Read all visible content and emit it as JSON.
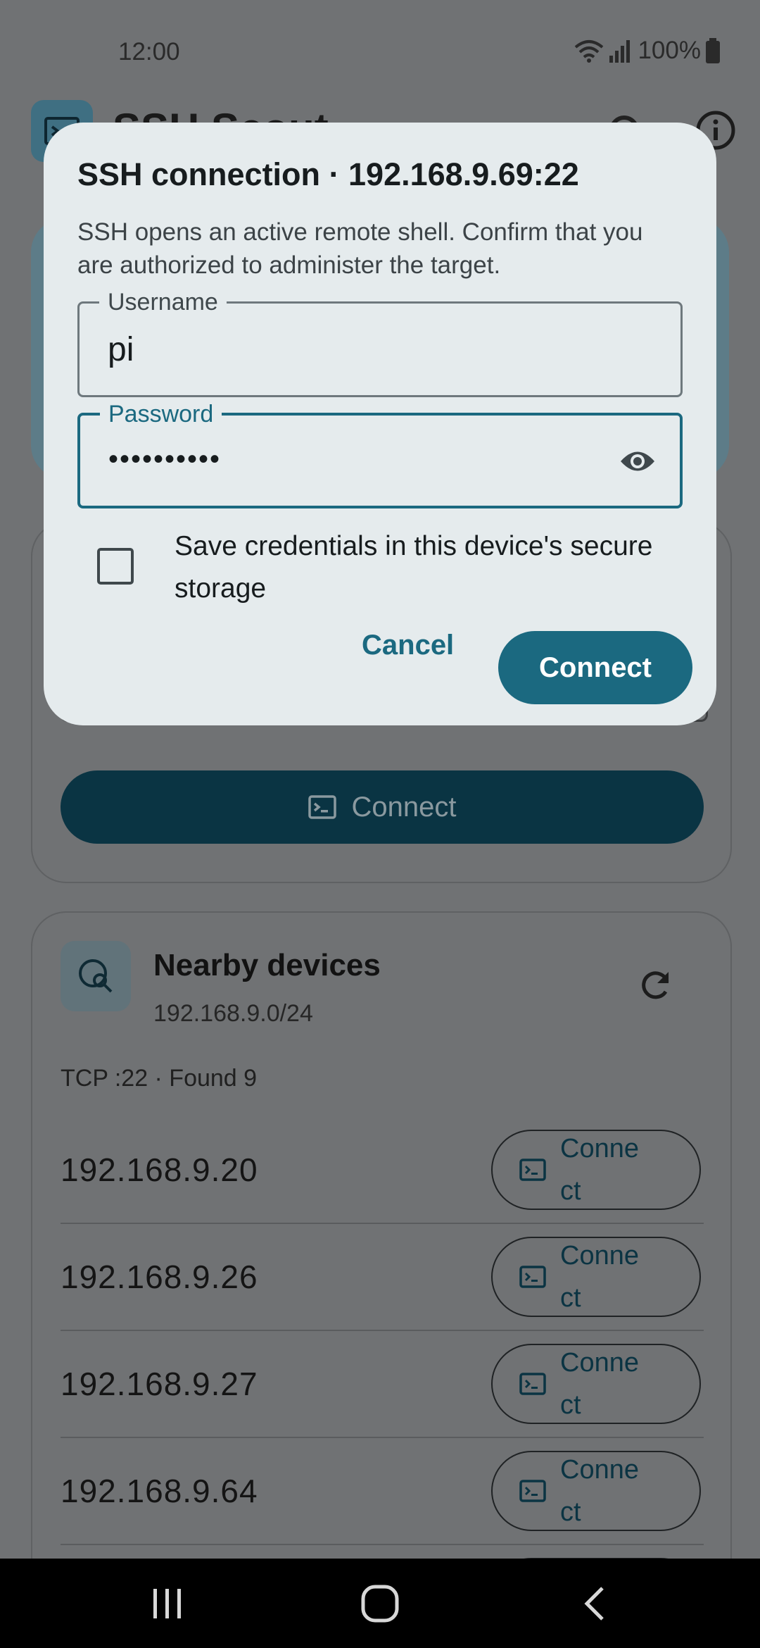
{
  "status_bar": {
    "time": "12:00",
    "battery": "100%"
  },
  "app": {
    "title": "SSH Scout"
  },
  "connect_card": {
    "connect_label": "Connect"
  },
  "nearby": {
    "title": "Nearby devices",
    "subnet": "192.168.9.0/24",
    "summary": "TCP :22 · Found 9",
    "devices": [
      {
        "ip": "192.168.9.20",
        "action": "Connect"
      },
      {
        "ip": "192.168.9.26",
        "action": "Connect"
      },
      {
        "ip": "192.168.9.27",
        "action": "Connect"
      },
      {
        "ip": "192.168.9.64",
        "action": "Connect"
      }
    ]
  },
  "dialog": {
    "title": "SSH connection · 192.168.9.69:22",
    "body": "SSH opens an active remote shell. Confirm that you are authorized to administer the target.",
    "username_label": "Username",
    "username_value": "pi",
    "password_label": "Password",
    "password_mask": "••••••••••",
    "save_label": "Save credentials in this device's secure storage",
    "save_checked": false,
    "cancel_label": "Cancel",
    "connect_label": "Connect"
  },
  "colors": {
    "primary": "#1b6980",
    "dialog_bg": "#e5ebed",
    "scrim": "#707274"
  }
}
